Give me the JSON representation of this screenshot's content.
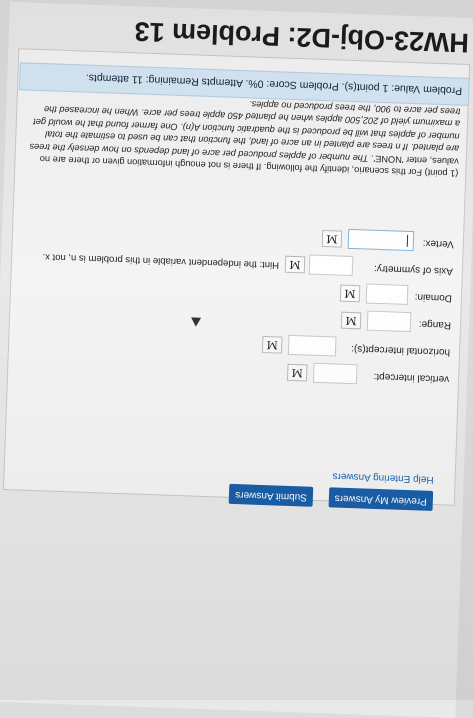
{
  "page": {
    "title": "HW23-Obj-D2: Problem 13"
  },
  "status": {
    "text": "Problem Value: 1 point(s). Problem Score: 0%. Attempts Remaining: 11 attempts."
  },
  "problem": {
    "intro": "(1 point) For this scenario, identify the following. If there is not enough information given or there are no values, enter 'NONE'.",
    "body": "The number of apples produced per acre of land depends on how densely the trees are planted. If n trees are planted in an acre of land, the function that can be used to estimate the total number of apples that will be produced is the quadratic function A(n). One farmer found that he would get a maximum yield of 202,500 apples when he planted 450 apple trees per acre. When he increased the trees per acre to 900, the trees produced no apples."
  },
  "fields": {
    "vertex_label": "Vertex:",
    "axis_label": "Axis of symmetry:",
    "axis_hint": "Hint: the independent variable in this problem is n, not x.",
    "domain_label": "Domain:",
    "range_label": "Range:",
    "hintercept_label": "horizontal intercept(s):",
    "vintercept_label": "vertical intercept:",
    "m_glyph": "M"
  },
  "links": {
    "help": "Help Entering Answers"
  },
  "buttons": {
    "preview": "Preview My Answers",
    "submit": "Submit Answers"
  }
}
